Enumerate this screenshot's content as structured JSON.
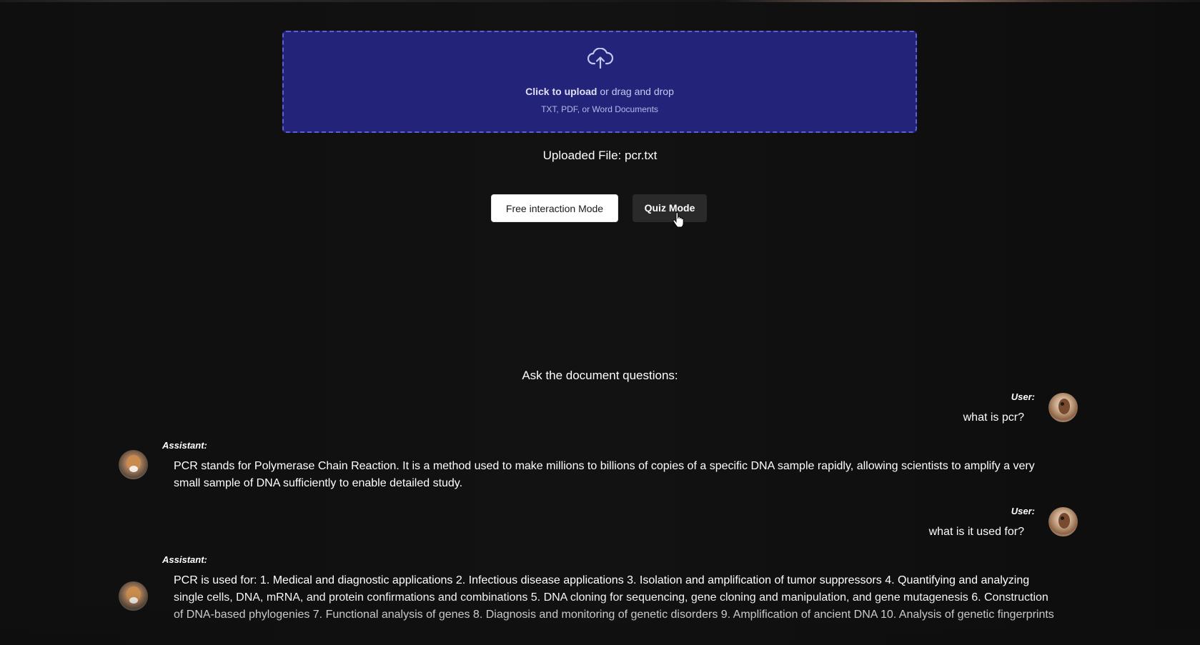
{
  "upload": {
    "icon": "cloud-upload-icon",
    "click_text": "Click to upload",
    "drag_text": " or drag and drop",
    "formats": "TXT, PDF, or Word Documents"
  },
  "uploaded_file": "Uploaded File: pcr.txt",
  "modes": {
    "free_label": "Free interaction Mode",
    "quiz_label": "Quiz Mode"
  },
  "chat": {
    "prompt": "Ask the document questions:",
    "messages": [
      {
        "role": "User:",
        "text": "what is pcr?"
      },
      {
        "role": "Assistant:",
        "text": "PCR stands for Polymerase Chain Reaction. It is a method used to make millions to billions of copies of a specific DNA sample rapidly, allowing scientists to amplify a very small sample of DNA sufficiently to enable detailed study."
      },
      {
        "role": "User:",
        "text": "what is it used for?"
      },
      {
        "role": "Assistant:",
        "text": "PCR is used for: 1. Medical and diagnostic applications 2. Infectious disease applications 3. Isolation and amplification of tumor suppressors 4. Quantifying and analyzing single cells, DNA, mRNA, and protein confirmations and combinations 5. DNA cloning for sequencing, gene cloning and manipulation, and gene mutagenesis 6. Construction of DNA-based phylogenies 7. Functional analysis of genes 8. Diagnosis and monitoring of genetic disorders 9. Amplification of ancient DNA 10. Analysis of genetic fingerprints"
      }
    ]
  },
  "colors": {
    "background": "#0e0e0e",
    "dropzone": "#23237a",
    "dropzone_border": "#5a5fd8",
    "button_light": "#ffffff",
    "button_dark": "#2a2a2a"
  }
}
